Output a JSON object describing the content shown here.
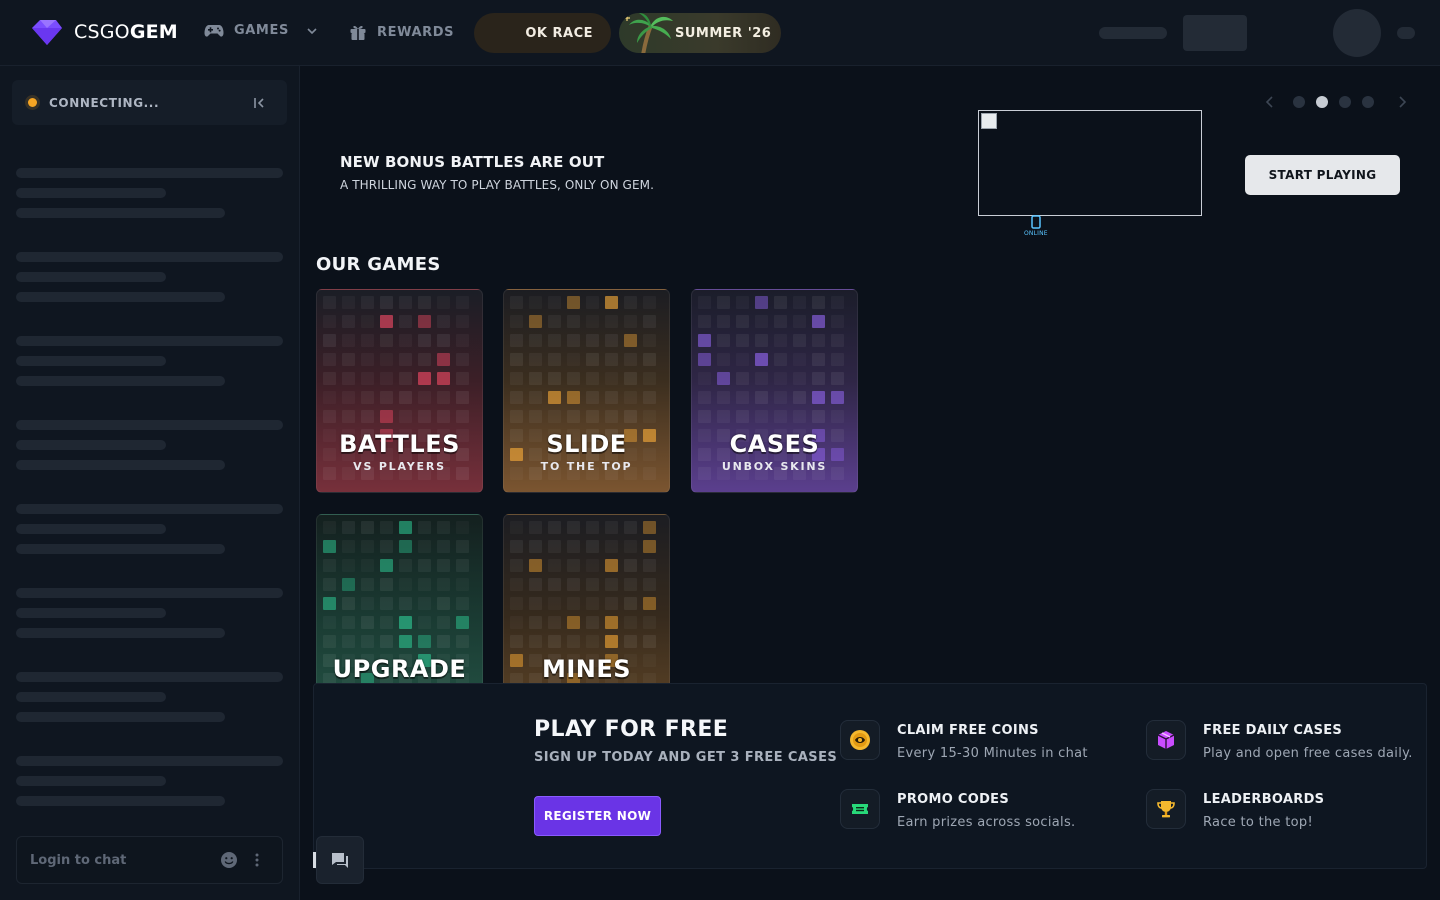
{
  "brand": {
    "name_light": "CSGO",
    "name_bold": "GEM",
    "color": "#7b4dff"
  },
  "nav": {
    "games_label": "GAMES",
    "rewards_label": "REWARDS",
    "race_label": "OK RACE",
    "summer_label": "SUMMER '26"
  },
  "sidebar": {
    "status_text": "CONNECTING...",
    "status_color": "#f5a524",
    "chat_placeholder": "Login to chat"
  },
  "banner": {
    "title": "NEW BONUS BATTLES ARE OUT",
    "subtitle": "A THRILLING WAY TO PLAY BATTLES, ONLY ON GEM.",
    "cta_label": "START PLAYING",
    "online_label": "ONLINE",
    "carousel_active_index": 1,
    "carousel_count": 4
  },
  "games": {
    "section_title": "OUR GAMES",
    "items": [
      {
        "name": "BATTLES",
        "subtitle": "VS PLAYERS",
        "accent": "#ff4d6a"
      },
      {
        "name": "SLIDE",
        "subtitle": "TO THE TOP",
        "accent": "#ffb03a"
      },
      {
        "name": "CASES",
        "subtitle": "UNBOX SKINS",
        "accent": "#9b6bff"
      },
      {
        "name": "UPGRADE",
        "subtitle": "",
        "accent": "#2fd39a"
      },
      {
        "name": "MINES",
        "subtitle": "",
        "accent": "#ffae35"
      }
    ]
  },
  "promo": {
    "title": "PLAY FOR FREE",
    "subtitle": "SIGN UP TODAY AND GET 3 FREE CASES",
    "register_label": "REGISTER NOW",
    "features": [
      {
        "title": "CLAIM FREE COINS",
        "desc": "Every 15-30 Minutes in chat",
        "icon": "coin-icon"
      },
      {
        "title": "FREE DAILY CASES",
        "desc": "Play and open free cases daily.",
        "icon": "case-icon"
      },
      {
        "title": "PROMO CODES",
        "desc": "Earn prizes across socials.",
        "icon": "ticket-icon"
      },
      {
        "title": "LEADERBOARDS",
        "desc": "Race to the top!",
        "icon": "trophy-icon"
      }
    ]
  }
}
